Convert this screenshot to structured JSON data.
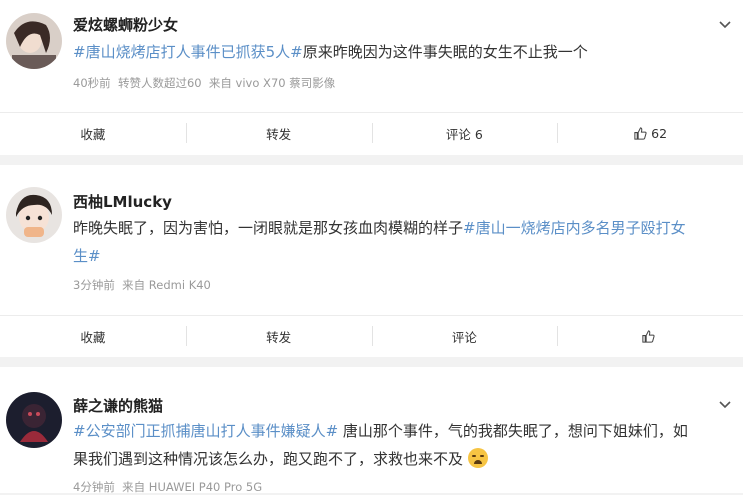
{
  "posts": [
    {
      "username": "爱炫螺蛳粉少女",
      "hashtag": "#唐山烧烤店打人事件已抓获5人#",
      "text": "原来昨晚因为这件事失眠的女生不止我一个",
      "time": "40秒前",
      "repost_info": "转赞人数超过60",
      "source": "来自 vivo X70 蔡司影像",
      "actions": {
        "collect": "收藏",
        "repost": "转发",
        "comment": "评论 6",
        "like": "62"
      }
    },
    {
      "username": "西柚LMlucky",
      "text": "昨晚失眠了，因为害怕，一闭眼就是那女孩血肉模糊的样子",
      "hashtag_line1": "#唐山一烧烤店内多名男子殴打女",
      "hashtag_line2": "生#",
      "time": "3分钟前",
      "source": "来自 Redmi K40",
      "actions": {
        "collect": "收藏",
        "repost": "转发",
        "comment": "评论",
        "like": ""
      }
    },
    {
      "username": "薛之谦的熊猫",
      "hashtag": "#公安部门正抓捕唐山打人事件嫌疑人#",
      "text_line1": " 唐山那个事件，气的我都失眠了，想问下姐妹们，如",
      "text_line2": "果我们遇到这种情况该怎么办，跑又跑不了，求救也来不及",
      "emoji": "crying-face-emoji",
      "time": "4分钟前",
      "source": "来自 HUAWEI P40 Pro 5G"
    }
  ],
  "icons": [
    "chevron-down-icon",
    "thumbs-up-icon"
  ],
  "colors": {
    "hashtag": "#5b8fc7",
    "meta": "#9a9a9a",
    "background": "#f2f2f2"
  }
}
